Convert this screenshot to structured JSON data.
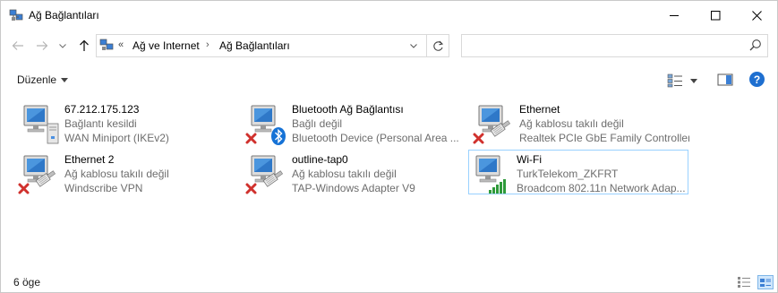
{
  "window": {
    "title": "Ağ Bağlantıları"
  },
  "address": {
    "overflow_chevron": "«",
    "crumbs": [
      "Ağ ve Internet",
      "Ağ Bağlantıları"
    ],
    "separator": "›"
  },
  "search": {
    "placeholder": ""
  },
  "toolbar": {
    "organize_label": "Düzenle",
    "help_label": "?"
  },
  "connections": [
    {
      "name": "67.212.175.123",
      "status": "Bağlantı kesildi",
      "device": "WAN Miniport (IKEv2)",
      "icon": "vpn-connection-icon",
      "selected": false
    },
    {
      "name": "Bluetooth Ağ Bağlantısı",
      "status": "Bağlı değil",
      "device": "Bluetooth Device (Personal Area ...",
      "icon": "bluetooth-network-icon",
      "selected": false
    },
    {
      "name": "Ethernet",
      "status": "Ağ kablosu takılı değil",
      "device": "Realtek PCIe GbE Family Controller",
      "icon": "ethernet-disconnected-icon",
      "selected": false
    },
    {
      "name": "Ethernet 2",
      "status": "Ağ kablosu takılı değil",
      "device": "Windscribe VPN",
      "icon": "ethernet-disconnected-icon",
      "selected": false
    },
    {
      "name": "outline-tap0",
      "status": "Ağ kablosu takılı değil",
      "device": "TAP-Windows Adapter V9",
      "icon": "ethernet-disconnected-icon",
      "selected": false
    },
    {
      "name": "Wi-Fi",
      "status": "TurkTelekom_ZKFRT",
      "device": "Broadcom 802.11n Network Adap...",
      "icon": "wifi-connected-icon",
      "selected": true
    }
  ],
  "statusbar": {
    "item_count": "6 öge"
  },
  "colors": {
    "accent": "#1e6fd0",
    "selection_border": "#99d1ff",
    "disconnected_x": "#d0312d",
    "wifi_green": "#3aa03a",
    "secondary_text": "#6d6d6d"
  }
}
